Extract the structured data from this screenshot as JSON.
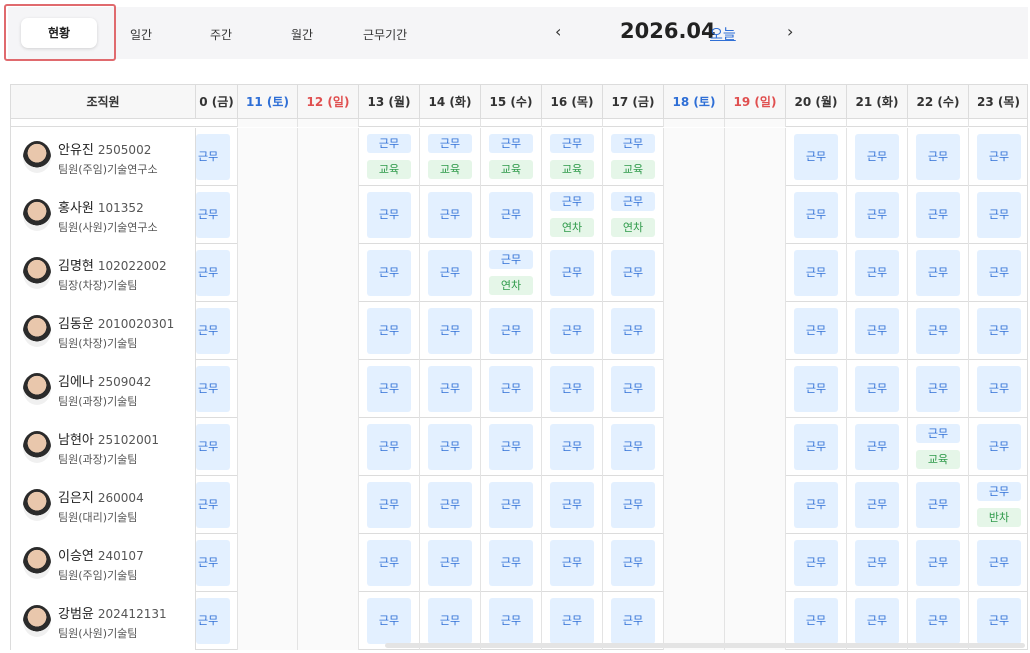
{
  "tabs": [
    {
      "label": "현황",
      "active": true
    },
    {
      "label": "일간"
    },
    {
      "label": "주간"
    },
    {
      "label": "월간"
    },
    {
      "label": "근무기간"
    }
  ],
  "nav": {
    "prev_icon": "chevron-left-icon",
    "next_icon": "chevron-right-icon",
    "month": "2026.04",
    "today": "오늘"
  },
  "table": {
    "name_header": "조직원",
    "days": [
      {
        "label": "0 (금)",
        "type": "weekday"
      },
      {
        "label": "11 (토)",
        "type": "sat"
      },
      {
        "label": "12 (일)",
        "type": "sun"
      },
      {
        "label": "13 (월)",
        "type": "weekday"
      },
      {
        "label": "14 (화)",
        "type": "weekday"
      },
      {
        "label": "15 (수)",
        "type": "weekday"
      },
      {
        "label": "16 (목)",
        "type": "weekday"
      },
      {
        "label": "17 (금)",
        "type": "weekday"
      },
      {
        "label": "18 (토)",
        "type": "sat"
      },
      {
        "label": "19 (일)",
        "type": "sun"
      },
      {
        "label": "20 (월)",
        "type": "weekday"
      },
      {
        "label": "21 (화)",
        "type": "weekday"
      },
      {
        "label": "22 (수)",
        "type": "weekday"
      },
      {
        "label": "23 (목)",
        "type": "weekday"
      }
    ],
    "employees": [
      {
        "name": "안유진",
        "id": "2505002",
        "dept": "팀원(주임)기술연구소",
        "cells": [
          [
            "근무"
          ],
          [],
          [],
          [
            "근무",
            "교육"
          ],
          [
            "근무",
            "교육"
          ],
          [
            "근무",
            "교육"
          ],
          [
            "근무",
            "교육"
          ],
          [
            "근무",
            "교육"
          ],
          [],
          [],
          [
            "근무"
          ],
          [
            "근무"
          ],
          [
            "근무"
          ],
          [
            "근무"
          ]
        ]
      },
      {
        "name": "홍사원",
        "id": "101352",
        "dept": "팀원(사원)기술연구소",
        "cells": [
          [
            "근무"
          ],
          [],
          [],
          [
            "근무"
          ],
          [
            "근무"
          ],
          [
            "근무"
          ],
          [
            "근무",
            "연차"
          ],
          [
            "근무",
            "연차"
          ],
          [],
          [],
          [
            "근무"
          ],
          [
            "근무"
          ],
          [
            "근무"
          ],
          [
            "근무"
          ]
        ]
      },
      {
        "name": "김명현",
        "id": "102022002",
        "dept": "팀장(차장)기술팀",
        "cells": [
          [
            "근무"
          ],
          [],
          [],
          [
            "근무"
          ],
          [
            "근무"
          ],
          [
            "근무",
            "연차"
          ],
          [
            "근무"
          ],
          [
            "근무"
          ],
          [],
          [],
          [
            "근무"
          ],
          [
            "근무"
          ],
          [
            "근무"
          ],
          [
            "근무"
          ]
        ]
      },
      {
        "name": "김동운",
        "id": "2010020301",
        "dept": "팀원(차장)기술팀",
        "cells": [
          [
            "근무"
          ],
          [],
          [],
          [
            "근무"
          ],
          [
            "근무"
          ],
          [
            "근무"
          ],
          [
            "근무"
          ],
          [
            "근무"
          ],
          [],
          [],
          [
            "근무"
          ],
          [
            "근무"
          ],
          [
            "근무"
          ],
          [
            "근무"
          ]
        ]
      },
      {
        "name": "김에나",
        "id": "2509042",
        "dept": "팀원(과장)기술팀",
        "cells": [
          [
            "근무"
          ],
          [],
          [],
          [
            "근무"
          ],
          [
            "근무"
          ],
          [
            "근무"
          ],
          [
            "근무"
          ],
          [
            "근무"
          ],
          [],
          [],
          [
            "근무"
          ],
          [
            "근무"
          ],
          [
            "근무"
          ],
          [
            "근무"
          ]
        ]
      },
      {
        "name": "남현아",
        "id": "25102001",
        "dept": "팀원(과장)기술팀",
        "cells": [
          [
            "근무"
          ],
          [],
          [],
          [
            "근무"
          ],
          [
            "근무"
          ],
          [
            "근무"
          ],
          [
            "근무"
          ],
          [
            "근무"
          ],
          [],
          [],
          [
            "근무"
          ],
          [
            "근무"
          ],
          [
            "근무",
            "교육"
          ],
          [
            "근무"
          ]
        ]
      },
      {
        "name": "김은지",
        "id": "260004",
        "dept": "팀원(대리)기술팀",
        "cells": [
          [
            "근무"
          ],
          [],
          [],
          [
            "근무"
          ],
          [
            "근무"
          ],
          [
            "근무"
          ],
          [
            "근무"
          ],
          [
            "근무"
          ],
          [],
          [],
          [
            "근무"
          ],
          [
            "근무"
          ],
          [
            "근무"
          ],
          [
            "근무",
            "반차"
          ]
        ]
      },
      {
        "name": "이승연",
        "id": "240107",
        "dept": "팀원(주임)기술팀",
        "cells": [
          [
            "근무"
          ],
          [],
          [],
          [
            "근무"
          ],
          [
            "근무"
          ],
          [
            "근무"
          ],
          [
            "근무"
          ],
          [
            "근무"
          ],
          [],
          [],
          [
            "근무"
          ],
          [
            "근무"
          ],
          [
            "근무"
          ],
          [
            "근무"
          ]
        ]
      },
      {
        "name": "강범윤",
        "id": "202412131",
        "dept": "팀원(사원)기술팀",
        "cells": [
          [
            "근무"
          ],
          [],
          [],
          [
            "근무"
          ],
          [
            "근무"
          ],
          [
            "근무"
          ],
          [
            "근무"
          ],
          [
            "근무"
          ],
          [],
          [],
          [
            "근무"
          ],
          [
            "근무"
          ],
          [
            "근무"
          ],
          [
            "근무"
          ]
        ]
      }
    ]
  },
  "colors": {
    "accent": "#2f6fd6",
    "sat": "#2f6fd6",
    "sun": "#e05050",
    "work_bg": "#e3f0ff",
    "leave_bg": "#e5f6e8",
    "highlight": "#e06a6e"
  }
}
